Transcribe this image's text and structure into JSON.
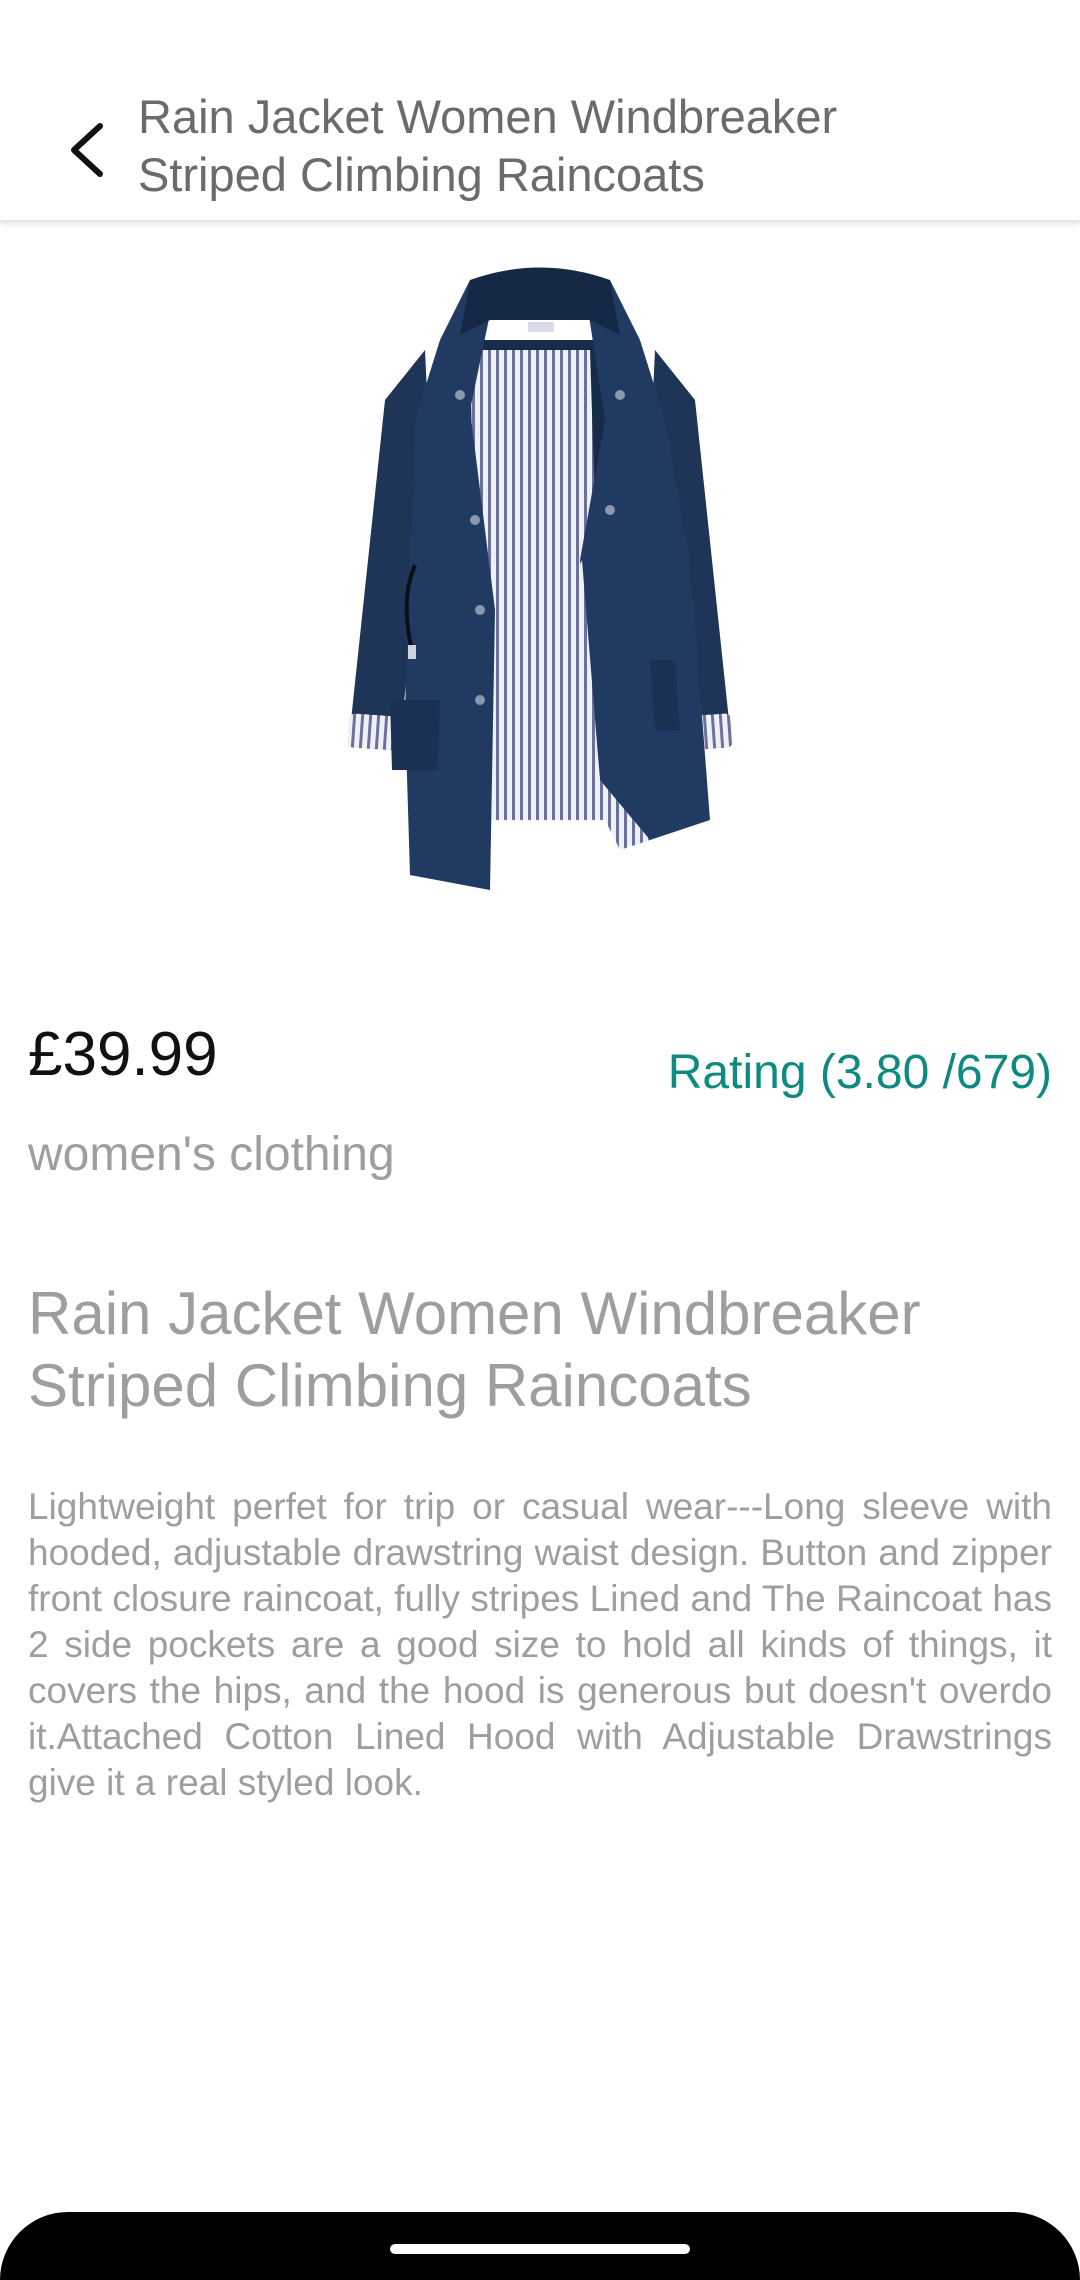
{
  "app_bar": {
    "title": "Rain Jacket Women Windbreaker Striped Climbing Raincoats",
    "back_icon": "chevron-left-icon"
  },
  "product": {
    "image_label": "navy-rain-jacket",
    "price": "£39.99",
    "rating": "Rating (3.80 /679)",
    "category": "women's clothing",
    "title": "Rain Jacket Women Windbreaker Striped Climbing Raincoats",
    "description": "Lightweight perfet for trip or casual wear---Long sleeve with hooded, adjustable drawstring waist design. Button and zipper front closure raincoat, fully stripes Lined and The Raincoat has 2 side pockets are a good size to hold all kinds of things, it covers the hips, and the hood is generous but doesn't overdo it.Attached Cotton Lined Hood with Adjustable Drawstrings give it a real styled look."
  },
  "colors": {
    "accent": "#0f8a7f",
    "text_muted": "#9e9e9e",
    "jacket_navy": "#1e3557"
  }
}
